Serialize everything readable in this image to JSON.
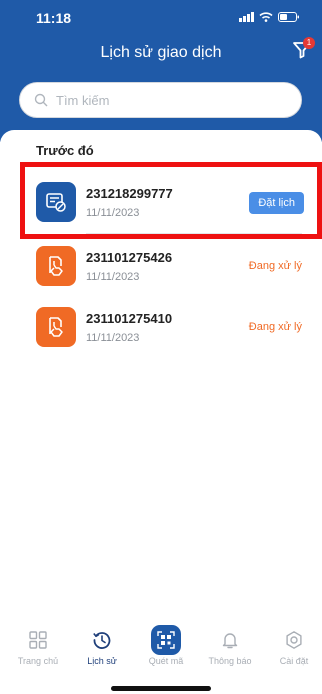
{
  "status_bar": {
    "time": "11:18"
  },
  "header": {
    "title": "Lịch sử giao dịch",
    "filter_badge": "1"
  },
  "search": {
    "placeholder": "Tìm kiếm"
  },
  "section": {
    "title": "Trước đó"
  },
  "transactions": [
    {
      "code": "231218299777",
      "date": "11/11/2023",
      "action": "Đặt lịch",
      "icon": "document-check-icon"
    },
    {
      "code": "231101275426",
      "date": "11/11/2023",
      "status": "Đang xử lý",
      "icon": "document-hand-icon"
    },
    {
      "code": "231101275410",
      "date": "11/11/2023",
      "status": "Đang xử lý",
      "icon": "document-hand-icon"
    }
  ],
  "tabs": [
    {
      "label": "Trang chủ",
      "icon": "grid-icon"
    },
    {
      "label": "Lịch sử",
      "icon": "history-icon"
    },
    {
      "label": "Quét mã",
      "icon": "qr-scan-icon"
    },
    {
      "label": "Thông báo",
      "icon": "bell-icon"
    },
    {
      "label": "Cài đặt",
      "icon": "gear-icon"
    }
  ],
  "colors": {
    "brand": "#1f5aa8",
    "accent_orange": "#f06a25",
    "highlight": "#ee1111",
    "button": "#4a8ee6"
  }
}
